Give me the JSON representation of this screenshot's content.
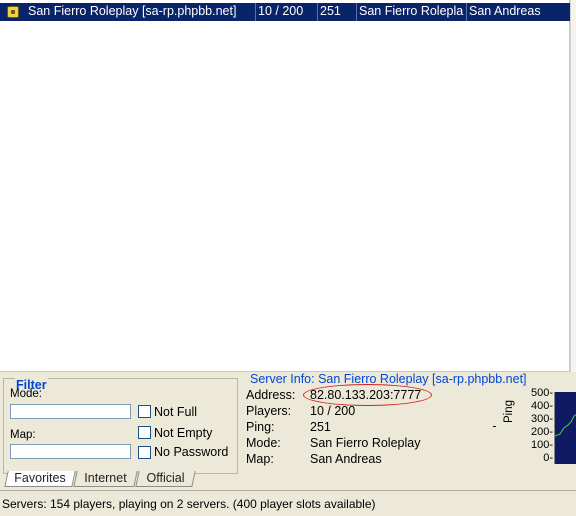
{
  "server_list": {
    "rows": [
      {
        "icon": "lock-icon",
        "hostname": "San Fierro Roleplay [sa-rp.phpbb.net]",
        "players": "10 / 200",
        "ping": "251",
        "mode": "San Fierro Rolepla",
        "map": "San Andreas"
      }
    ]
  },
  "filter": {
    "title": "Filter",
    "mode_label": "Mode:",
    "map_label": "Map:",
    "mode_value": "",
    "map_value": "",
    "not_full_label": "Not Full",
    "not_empty_label": "Not Empty",
    "no_password_label": "No Password",
    "not_full_checked": false,
    "not_empty_checked": false,
    "no_password_checked": false
  },
  "server_info": {
    "title": "Server Info: San Fierro Roleplay [sa-rp.phpbb.net]",
    "address_label": "Address:",
    "address": "82.80.133.203:7777",
    "players_label": "Players:",
    "players": "10 / 200",
    "ping_label": "Ping:",
    "ping": "251",
    "mode_label": "Mode:",
    "mode": "San Fierro Roleplay",
    "map_label": "Map:",
    "map": "San Andreas"
  },
  "ping_graph": {
    "axis_label": "Ping",
    "ticks": [
      "500-",
      "400-",
      "300-",
      "200-",
      "100-",
      "0-"
    ],
    "background_color": "#0f1a62",
    "line_color": "#3fd24a"
  },
  "tabs": [
    {
      "label": "Favorites",
      "active": true
    },
    {
      "label": "Internet",
      "active": false
    },
    {
      "label": "Official",
      "active": false
    }
  ],
  "status_bar": {
    "text": "Servers: 154 players, playing on 2 servers. (400 player slots available)"
  },
  "colors": {
    "selection": "#0a246a",
    "group_title": "#0046d5",
    "annotation_circle": "#d42020"
  }
}
